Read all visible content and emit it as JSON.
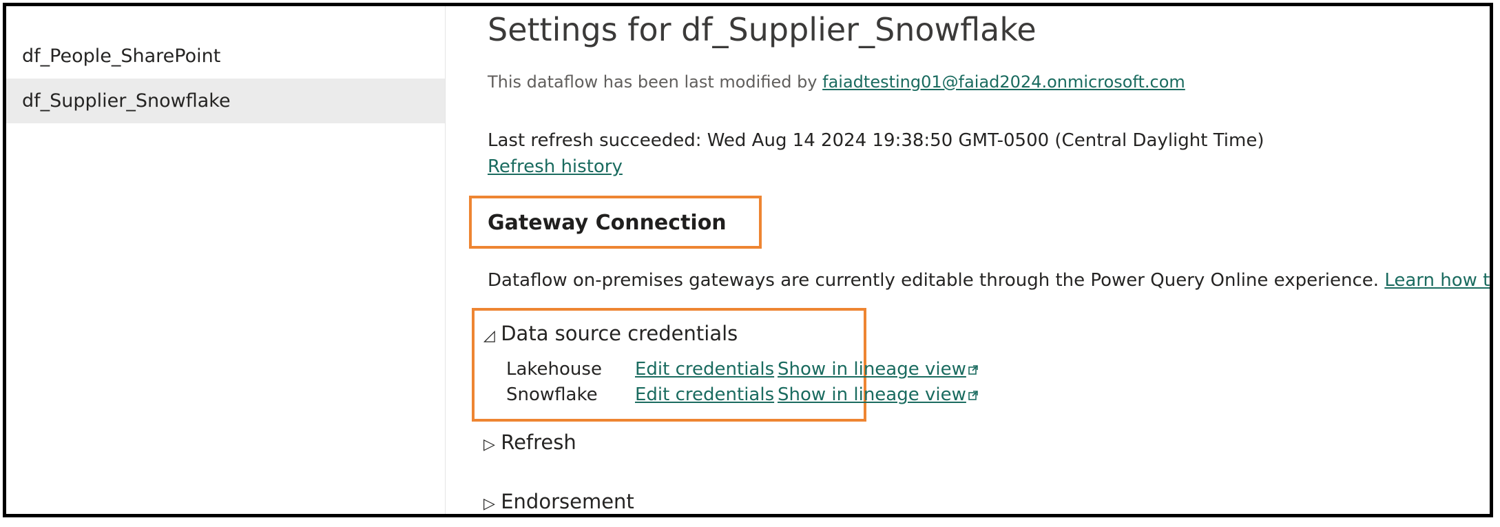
{
  "sidebar": {
    "items": [
      {
        "label": "df_People_SharePoint",
        "selected": false
      },
      {
        "label": "df_Supplier_Snowflake",
        "selected": true
      }
    ]
  },
  "main": {
    "title": "Settings for df_Supplier_Snowflake",
    "modified_prefix": "This dataflow has been last modified by ",
    "modified_by": "faiadtesting01@faiad2024.onmicrosoft.com",
    "last_refresh": "Last refresh succeeded: Wed Aug 14 2024 19:38:50 GMT-0500 (Central Daylight Time)",
    "refresh_history_label": "Refresh history",
    "gateway": {
      "heading": "Gateway Connection",
      "note": "Dataflow on-premises gateways are currently editable through the Power Query Online experience. ",
      "learn_link": "Learn how to edit"
    },
    "data_source_credentials": {
      "heading": "Data source credentials",
      "expanded_icon": "◿",
      "rows": [
        {
          "name": "Lakehouse",
          "edit_label": "Edit credentials",
          "lineage_label": "Show in lineage view"
        },
        {
          "name": "Snowflake",
          "edit_label": "Edit credentials",
          "lineage_label": "Show in lineage view"
        }
      ]
    },
    "sections": [
      {
        "label": "Refresh",
        "icon": "▷"
      },
      {
        "label": "Endorsement",
        "icon": "▷"
      }
    ]
  },
  "colors": {
    "highlight_border": "#ee8532",
    "link": "#1a6b5f",
    "selected_bg": "#ebebeb"
  }
}
